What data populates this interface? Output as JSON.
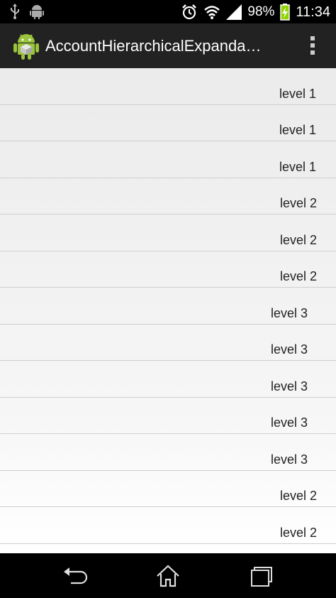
{
  "status_bar": {
    "battery_percent": "98%",
    "time": "11:34",
    "icons": [
      "usb-icon",
      "android-debug-icon",
      "alarm-icon",
      "wifi-icon",
      "signal-icon",
      "battery-charging-icon"
    ]
  },
  "action_bar": {
    "title": "AccountHierarchicalExpanda…",
    "icons": [
      "android-app-icon",
      "overflow-menu-icon"
    ]
  },
  "list": {
    "rows": [
      {
        "label": "level 1",
        "level": 1
      },
      {
        "label": "level 1",
        "level": 1
      },
      {
        "label": "level 1",
        "level": 1
      },
      {
        "label": "level 2",
        "level": 2
      },
      {
        "label": "level 2",
        "level": 2
      },
      {
        "label": "level 2",
        "level": 2
      },
      {
        "label": "level 3",
        "level": 3
      },
      {
        "label": "level 3",
        "level": 3
      },
      {
        "label": "level 3",
        "level": 3
      },
      {
        "label": "level 3",
        "level": 3
      },
      {
        "label": "level 3",
        "level": 3
      },
      {
        "label": "level 2",
        "level": 2
      },
      {
        "label": "level 2",
        "level": 2
      }
    ]
  },
  "nav_bar": {
    "icons": [
      "back-icon",
      "home-icon",
      "recent-apps-icon"
    ]
  },
  "colors": {
    "status_bar_bg": "#000000",
    "action_bar_bg": "#222222",
    "battery_green": "#8fd400",
    "android_green": "#9bc43d"
  }
}
